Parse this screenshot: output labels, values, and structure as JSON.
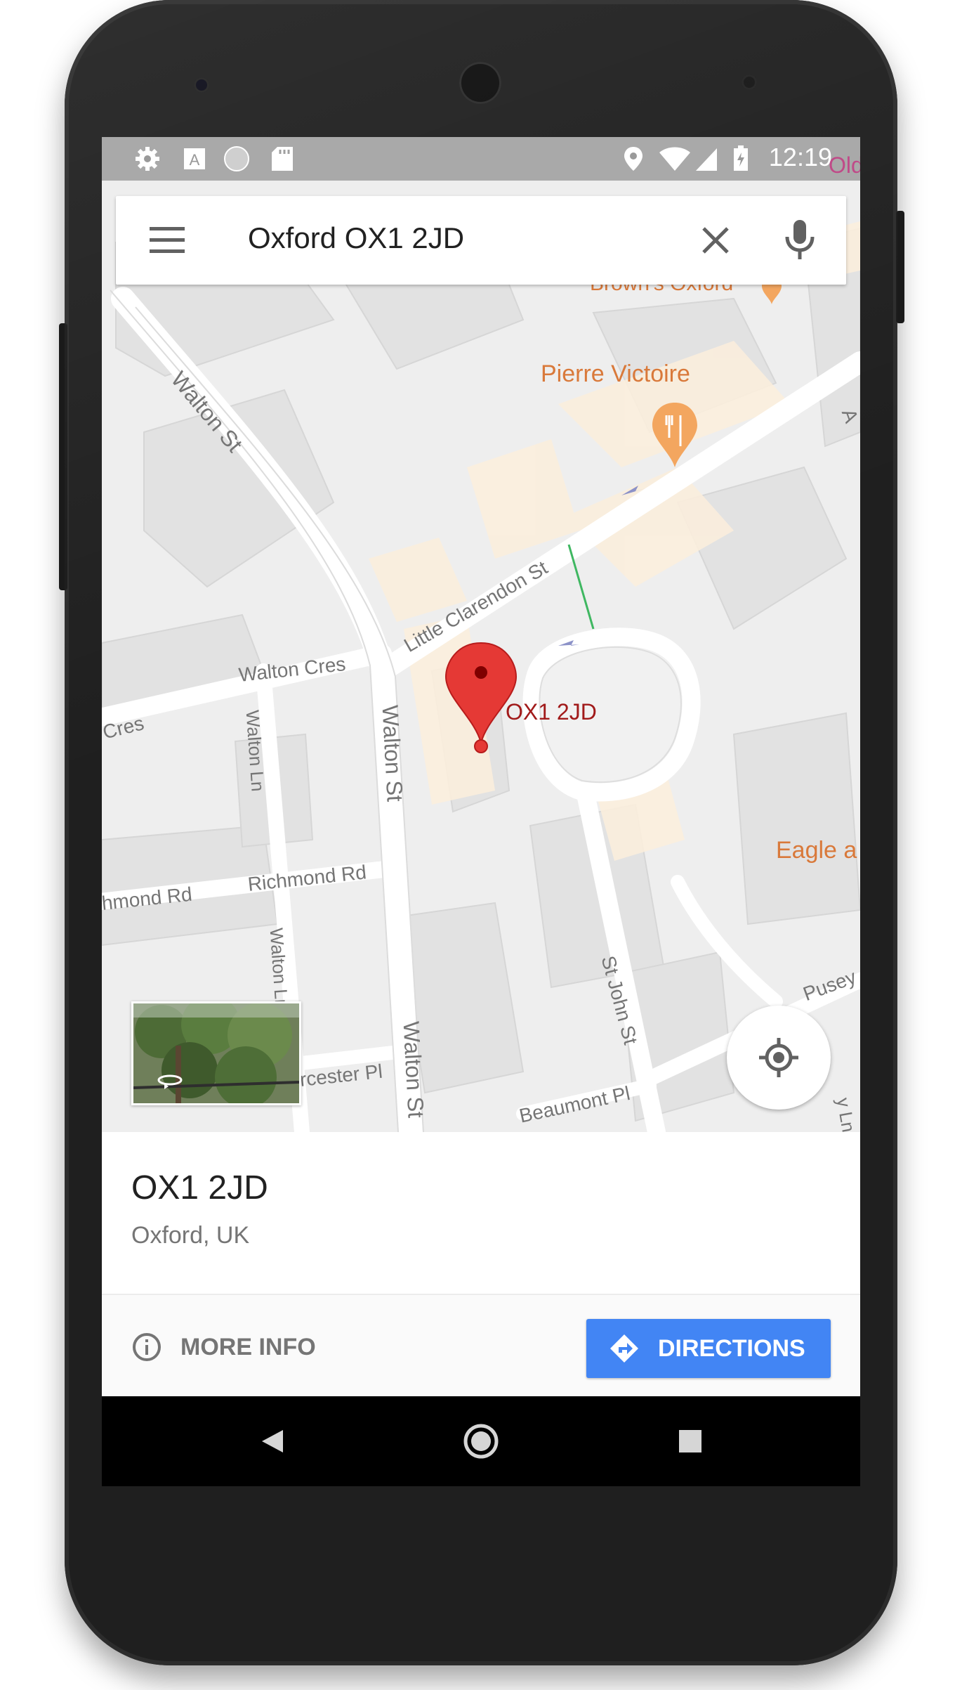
{
  "status_bar": {
    "time": "12:19",
    "left_icons": [
      "gear-icon",
      "font-a-icon",
      "circle-icon",
      "sd-card-icon"
    ],
    "right_icons": [
      "location-icon",
      "wifi-icon",
      "signal-icon",
      "battery-charging-icon"
    ]
  },
  "search": {
    "query": "Oxford OX1 2JD"
  },
  "map": {
    "streets": {
      "walton_st_top": "Walton St",
      "walton_st_mid": "Walton St",
      "walton_st_bottom": "Walton St",
      "little_clarendon_st": "Little Clarendon St",
      "walton_cres": "Walton Cres",
      "cres_left": "Cres",
      "walton_ln_1": "Walton Ln",
      "walton_ln_2": "Walton Ln",
      "richmond_rd_left": "hmond Rd",
      "richmond_rd": "Richmond Rd",
      "st_john_st": "St John St",
      "worcester_pl": "rcester Pl",
      "beaumont_pl": "Beaumont Pl",
      "pusey": "Pusey",
      "edge_right": "A",
      "edge_ln": "y Ln"
    },
    "pois": {
      "pierre_victoire": "Pierre Victoire",
      "eagle": "Eagle a",
      "old_parsonage": "Old Parson",
      "brown_partial": "Brown's Oxford"
    },
    "pin_label": "OX1 2JD",
    "colors": {
      "pin": "#e53935",
      "poi": "#d9793a",
      "accent": "#4285f4"
    }
  },
  "place": {
    "title": "OX1 2JD",
    "subtitle": "Oxford, UK"
  },
  "actions": {
    "more_info": "MORE INFO",
    "directions": "DIRECTIONS"
  },
  "nav": {
    "icons": [
      "back-icon",
      "home-icon",
      "recents-icon"
    ]
  }
}
